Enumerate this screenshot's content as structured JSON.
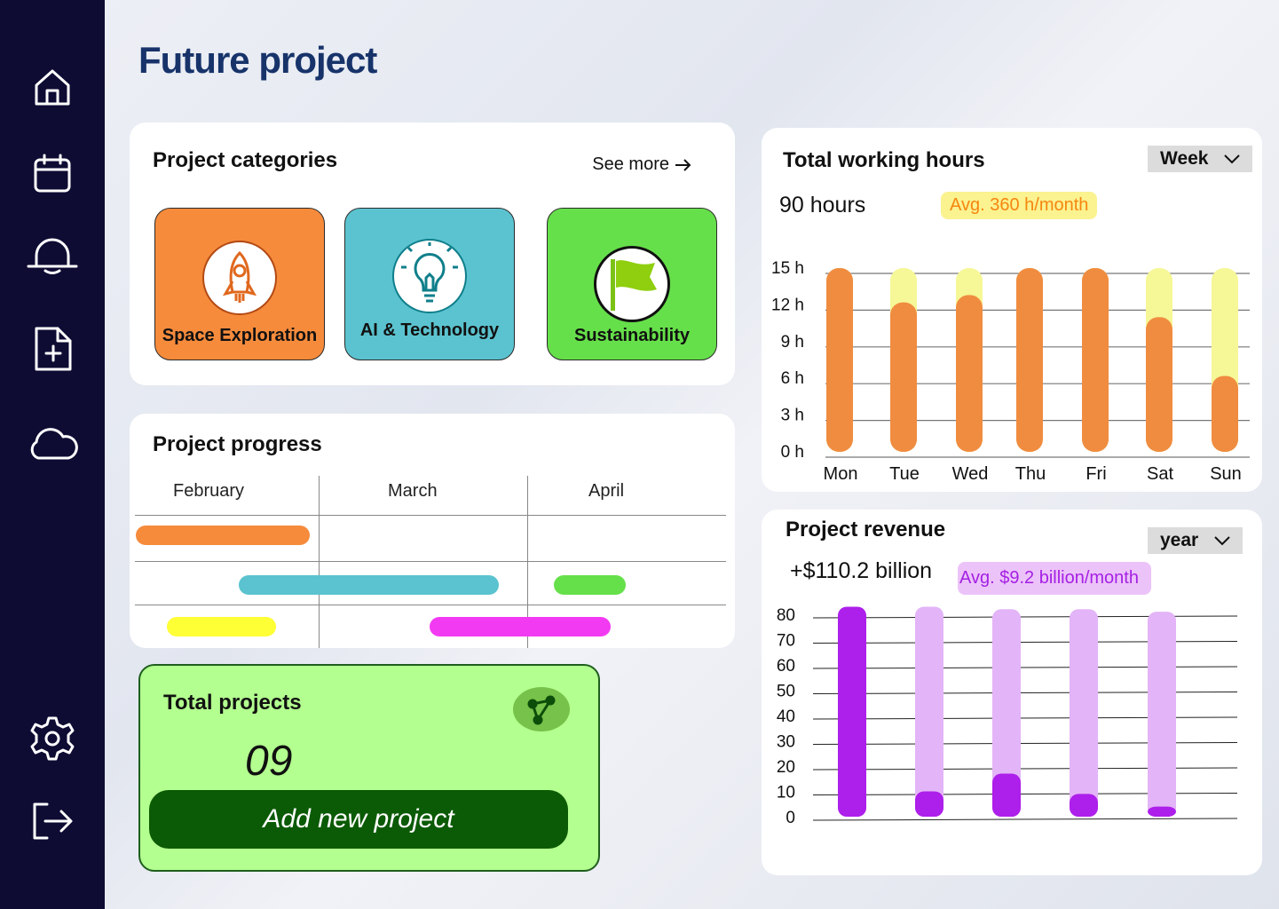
{
  "page_title": "Future project",
  "sidebar": {
    "items": [
      {
        "name": "home-icon"
      },
      {
        "name": "calendar-icon"
      },
      {
        "name": "bell-icon"
      },
      {
        "name": "file-add-icon"
      },
      {
        "name": "cloud-icon"
      },
      {
        "name": "settings-icon"
      },
      {
        "name": "logout-icon"
      }
    ]
  },
  "categories": {
    "title": "Project categories",
    "see_more": "See more",
    "items": [
      {
        "label": "Space Exploration",
        "icon": "rocket-icon",
        "color": "#f68b3c"
      },
      {
        "label": "AI & Technology",
        "icon": "lightbulb-icon",
        "color": "#5bc3cf"
      },
      {
        "label": "Sustainability",
        "icon": "flag-icon",
        "color": "#66e04a"
      }
    ]
  },
  "progress": {
    "title": "Project progress",
    "months": [
      "February",
      "March",
      "April"
    ],
    "bar_colors": [
      "#f68b3c",
      "#5bc3cf",
      "#66e04a",
      "#ffff36",
      "#f23af2"
    ]
  },
  "total_projects": {
    "title": "Total  projects",
    "count": "09",
    "add_button": "Add new project",
    "icon": "share-icon"
  },
  "working_hours": {
    "title": "Total working hours",
    "period": "Week",
    "total": "90 hours",
    "avg": "Avg. 360 h/month",
    "chart_data": {
      "type": "bar",
      "categories": [
        "Mon",
        "Tue",
        "Wed",
        "Thu",
        "Fri",
        "Sat",
        "Sun"
      ],
      "y_ticks": [
        "15 h",
        "12 h",
        "9 h",
        "6 h",
        "3 h",
        "0 h"
      ],
      "ylim": [
        0,
        15
      ],
      "series": [
        {
          "values": [
            15,
            12.2,
            12.8,
            15,
            15,
            11,
            6.2
          ],
          "color": "#f08c40"
        },
        {
          "values": [
            15,
            15,
            15,
            15,
            15,
            15,
            15
          ],
          "color": "#f6f797"
        }
      ]
    }
  },
  "revenue": {
    "title": "Project revenue",
    "period": "year",
    "total": "+$110.2 billion",
    "avg": "Avg. $9.2 billion/month",
    "chart_data": {
      "type": "bar",
      "y_ticks": [
        "80",
        "70",
        "60",
        "50",
        "40",
        "30",
        "20",
        "10",
        "0"
      ],
      "ylim": [
        0,
        80
      ],
      "series": [
        {
          "values": [
            83,
            10,
            17,
            9,
            4
          ],
          "color": "#ad1fea"
        },
        {
          "values": [
            83,
            83,
            82,
            82,
            81
          ],
          "color": "#e3b4f7"
        }
      ]
    }
  }
}
